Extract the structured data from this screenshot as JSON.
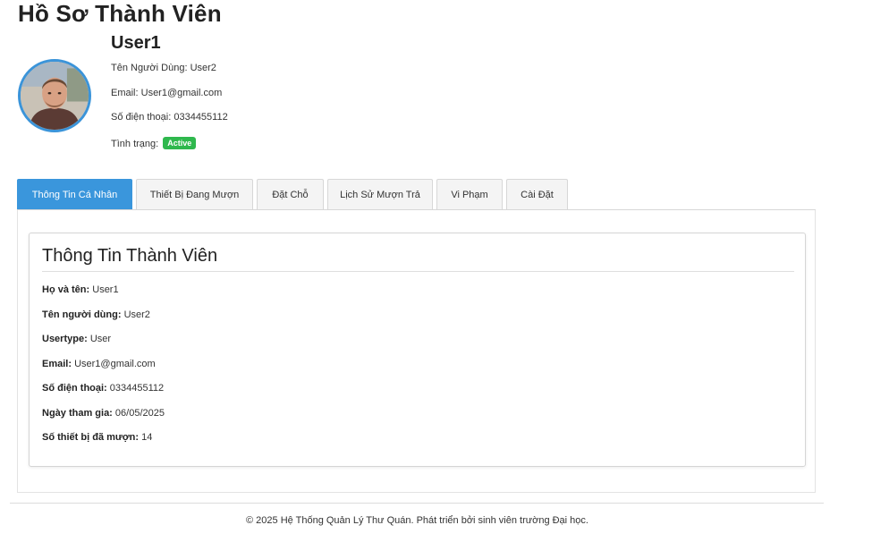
{
  "page": {
    "title": "Hồ Sơ Thành Viên"
  },
  "profile": {
    "avatar_icon": "user-avatar-photo",
    "name": "User1",
    "username_label": "Tên Người Dùng:",
    "username_value": "User2",
    "email_label": "Email:",
    "email_value": "User1@gmail.com",
    "phone_label": "Số điện thoại:",
    "phone_value": "0334455112",
    "status_label": "Tình trạng:",
    "status_value": "Active",
    "status_color": "#2fb84d",
    "avatar_border_color": "#3b94d9"
  },
  "tabs": [
    {
      "label": "Thông Tin Cá Nhân",
      "active": true
    },
    {
      "label": "Thiết Bị Đang Mượn",
      "active": false
    },
    {
      "label": "Đặt Chỗ",
      "active": false
    },
    {
      "label": "Lịch Sử Mượn Trả",
      "active": false
    },
    {
      "label": "Vi Phạm",
      "active": false
    },
    {
      "label": "Cài Đặt",
      "active": false
    }
  ],
  "active_tab_color": "#3a96dc",
  "info_card": {
    "title": "Thông Tin Thành Viên",
    "rows": [
      {
        "label": "Họ và tên:",
        "value": "User1"
      },
      {
        "label": "Tên người dùng:",
        "value": "User2"
      },
      {
        "label": "Usertype:",
        "value": "User"
      },
      {
        "label": "Email:",
        "value": "User1@gmail.com"
      },
      {
        "label": "Số điện thoại:",
        "value": "0334455112"
      },
      {
        "label": "Ngày tham gia:",
        "value": "06/05/2025"
      },
      {
        "label": "Số thiết bị đã mượn:",
        "value": "14"
      }
    ]
  },
  "footer": {
    "text": "© 2025 Hệ Thống Quản Lý Thư Quán. Phát triển bởi sinh viên trường Đại học."
  }
}
